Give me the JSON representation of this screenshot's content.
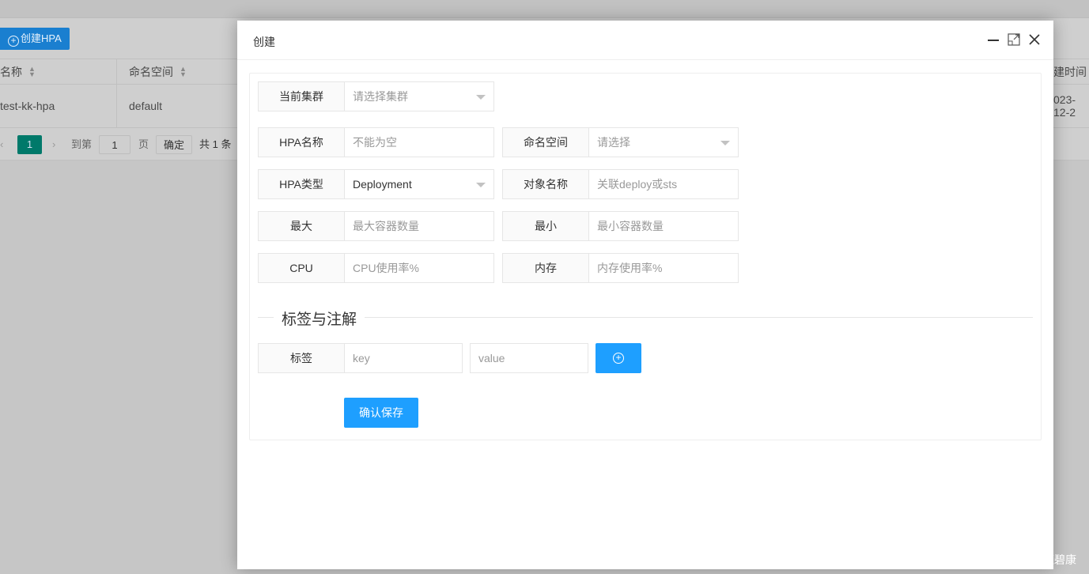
{
  "background": {
    "create_button": "创建HPA",
    "columns": [
      "名称",
      "命名空间",
      "建时间"
    ],
    "row": {
      "name": "test-kk-hpa",
      "namespace": "default",
      "created": "023-12-2"
    },
    "pagination": {
      "current": "1",
      "goto_label": "到第",
      "goto_value": "1",
      "page_label": "页",
      "confirm": "确定",
      "total": "共 1 条"
    }
  },
  "dialog": {
    "title": "创建",
    "cluster": {
      "label": "当前集群",
      "placeholder": "请选择集群"
    },
    "hpa_name": {
      "label": "HPA名称",
      "placeholder": "不能为空"
    },
    "namespace": {
      "label": "命名空间",
      "placeholder": "请选择"
    },
    "hpa_type": {
      "label": "HPA类型",
      "value": "Deployment"
    },
    "target_name": {
      "label": "对象名称",
      "placeholder": "关联deploy或sts"
    },
    "max": {
      "label": "最大",
      "placeholder": "最大容器数量"
    },
    "min": {
      "label": "最小",
      "placeholder": "最小容器数量"
    },
    "cpu": {
      "label": "CPU",
      "placeholder": "CPU使用率%"
    },
    "memory": {
      "label": "内存",
      "placeholder": "内存使用率%"
    },
    "section_title": "标签与注解",
    "tag": {
      "label": "标签",
      "key_placeholder": "key",
      "value_placeholder": "value"
    },
    "save_button": "确认保存"
  },
  "watermark": "CSDN @汪碧康",
  "colors": {
    "primary": "#1e9fff",
    "pager_active": "#009688"
  }
}
